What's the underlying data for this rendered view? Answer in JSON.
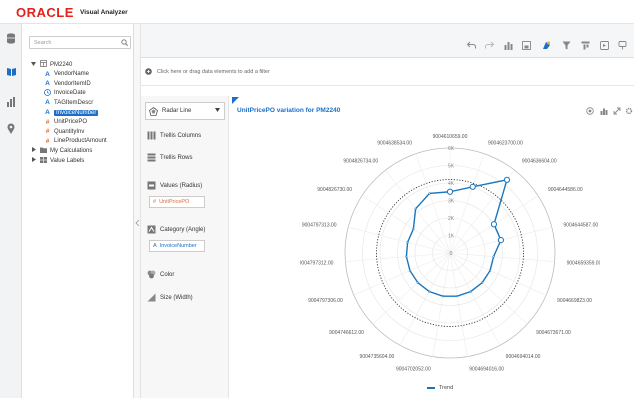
{
  "header": {
    "logo": "ORACLE",
    "product": "Visual Analyzer"
  },
  "rail": {
    "icons": [
      "database-icon",
      "book-icon",
      "bar-chart-icon",
      "pin-icon"
    ]
  },
  "data_panel": {
    "search_placeholder": "Search",
    "tree": [
      {
        "label": "PM2240",
        "icon": "table",
        "level": 0,
        "expanded": true,
        "color": "#555"
      },
      {
        "label": "VendorName",
        "icon": "A",
        "level": 1,
        "color": "#1b6fc9"
      },
      {
        "label": "VendorItemID",
        "icon": "A",
        "level": 1,
        "color": "#1b6fc9"
      },
      {
        "label": "InvoiceDate",
        "icon": "clock",
        "level": 1,
        "color": "#1b6fc9"
      },
      {
        "label": "TAGItemDescr",
        "icon": "A",
        "level": 1,
        "color": "#1b6fc9"
      },
      {
        "label": "InvoiceNumber",
        "icon": "A",
        "level": 1,
        "color": "#1b6fc9",
        "selected": true
      },
      {
        "label": "UnitPricePO",
        "icon": "#",
        "level": 1,
        "color": "#e06c3c"
      },
      {
        "label": "QuantityInv",
        "icon": "#",
        "level": 1,
        "color": "#e06c3c"
      },
      {
        "label": "LineProductAmount",
        "icon": "#",
        "level": 1,
        "color": "#e06c3c"
      },
      {
        "label": "My Calculations",
        "icon": "folder",
        "level": 0,
        "expanded": false,
        "color": "#555"
      },
      {
        "label": "Value Labels",
        "icon": "grid",
        "level": 0,
        "color": "#555"
      }
    ]
  },
  "toolbar": {
    "icons": [
      "undo-icon",
      "redo-icon",
      "chart-type-icon",
      "data-element-icon",
      "color-icon",
      "filter-icon",
      "sort-icon",
      "present-icon",
      "more-icon"
    ]
  },
  "filterbar": {
    "placeholder": "Click here or drag data elements to add a filter"
  },
  "grammar": {
    "chart_type": "Radar Line",
    "trellis_columns": "Trellis Columns",
    "trellis_rows": "Trellis Rows",
    "values_label": "Values (Radius)",
    "values_item": "UnitPricePO",
    "category_label": "Category (Angle)",
    "category_item": "InvoiceNumber",
    "color_label": "Color",
    "size_label": "Size (Width)"
  },
  "chart_data": {
    "type": "radar-line",
    "title": "UnitPricePO variation for PM2240",
    "categories": [
      "9004610659.00",
      "9004623700.00",
      "9004636604.00",
      "9004644586.00",
      "9004644587.00",
      "9004659359.00",
      "9004669823.00",
      "9004673671.00",
      "9004694014.00",
      "9004694016.00",
      "9004702052.00",
      "9004735604.00",
      "9004746612.00",
      "9004797306.00",
      "9004797312.00",
      "9004797313.00",
      "9004826730.00",
      "9004826734.00",
      "9004638534.00"
    ],
    "radial_ticks": [
      "0",
      "1K",
      "2K",
      "3K",
      "4K",
      "5K",
      "6K"
    ],
    "rmax": 6000,
    "series": [
      {
        "name": "Trend",
        "values": [
          3500,
          4000,
          5300,
          3000,
          3000,
          2500,
          2500,
          2500,
          2500,
          2500,
          2500,
          2500,
          2500,
          2500,
          2500,
          2500,
          2500,
          3200,
          3600
        ],
        "color": "#1b75bc"
      }
    ],
    "markers_at": [
      0,
      1,
      2,
      3,
      4
    ],
    "reference_ring": 4200,
    "legend": "Trend"
  }
}
